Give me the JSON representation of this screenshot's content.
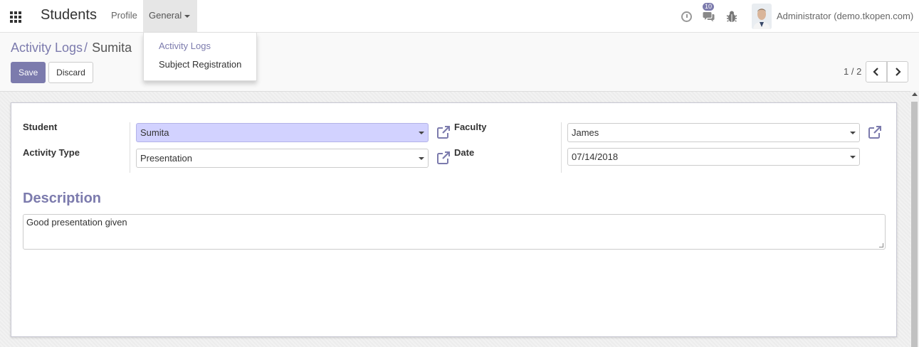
{
  "navbar": {
    "brand": "Students",
    "menu": {
      "profile": "Profile",
      "general": "General"
    },
    "notification_count": "10",
    "user": "Administrator (demo.tkopen.com)"
  },
  "dropdown": {
    "items": [
      "Activity Logs",
      "Subject Registration"
    ]
  },
  "breadcrumb": {
    "parent": "Activity Logs",
    "separator": "/",
    "current": "Sumita"
  },
  "buttons": {
    "save": "Save",
    "discard": "Discard"
  },
  "pager": {
    "value": "1 / 2"
  },
  "form": {
    "student_label": "Student",
    "student_value": "Sumita",
    "activity_type_label": "Activity Type",
    "activity_type_value": "Presentation",
    "faculty_label": "Faculty",
    "faculty_value": "James",
    "date_label": "Date",
    "date_value": "07/14/2018",
    "description_title": "Description",
    "description_value": "Good presentation given"
  },
  "colors": {
    "accent": "#7c7bad",
    "highlight": "#d2d2ff"
  },
  "icons": [
    "apps-grid-icon",
    "clock-icon",
    "chat-icon",
    "bug-icon",
    "external-link-icon",
    "chevron-left-icon",
    "chevron-right-icon"
  ]
}
